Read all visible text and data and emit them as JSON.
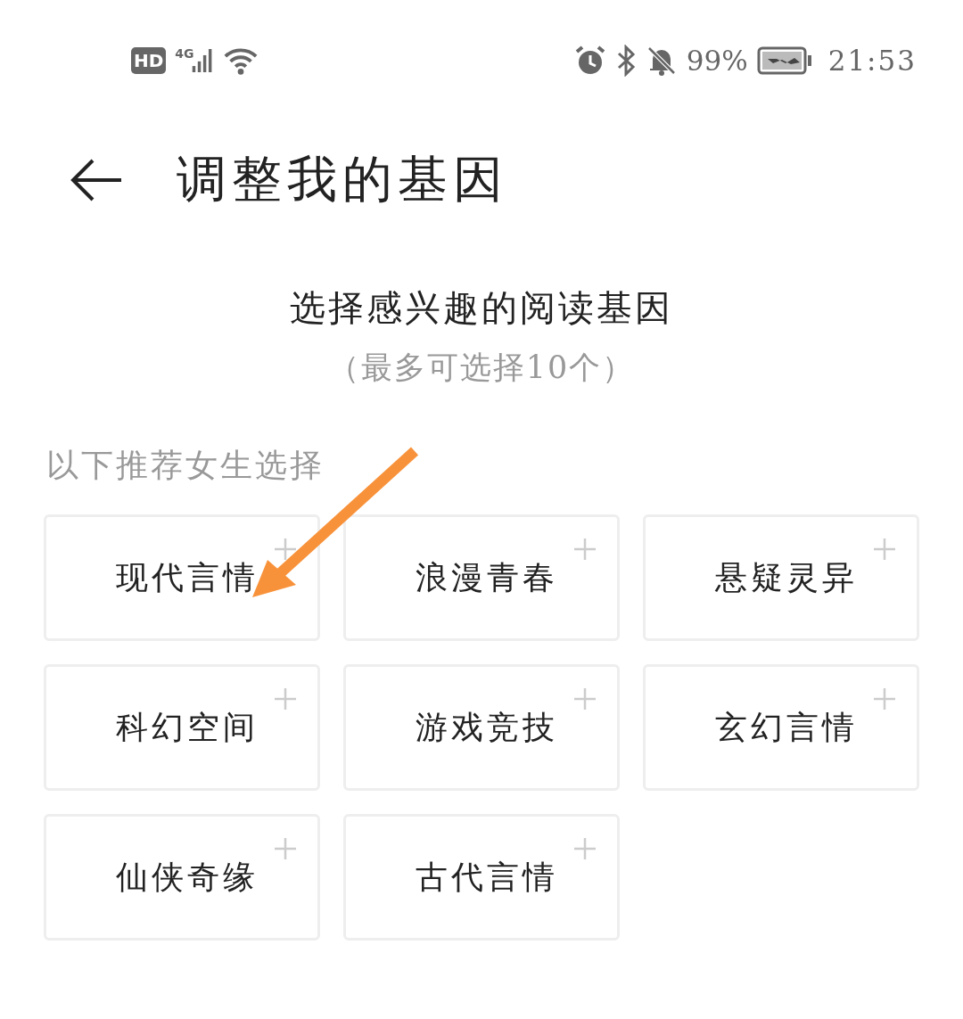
{
  "status_bar": {
    "hd_badge": "HD",
    "network_type": "4G",
    "battery_percent": "99%",
    "time": "21:53"
  },
  "header": {
    "title": "调整我的基因"
  },
  "intro": {
    "heading": "选择感兴趣的阅读基因",
    "hint": "（最多可选择10个）"
  },
  "section_label": "以下推荐女生选择",
  "genres": [
    {
      "label": "现代言情",
      "selected": false
    },
    {
      "label": "浪漫青春",
      "selected": false
    },
    {
      "label": "悬疑灵异",
      "selected": false
    },
    {
      "label": "科幻空间",
      "selected": false
    },
    {
      "label": "游戏竞技",
      "selected": false
    },
    {
      "label": "玄幻言情",
      "selected": false
    },
    {
      "label": "仙侠奇缘",
      "selected": false
    },
    {
      "label": "古代言情",
      "selected": false
    }
  ]
}
